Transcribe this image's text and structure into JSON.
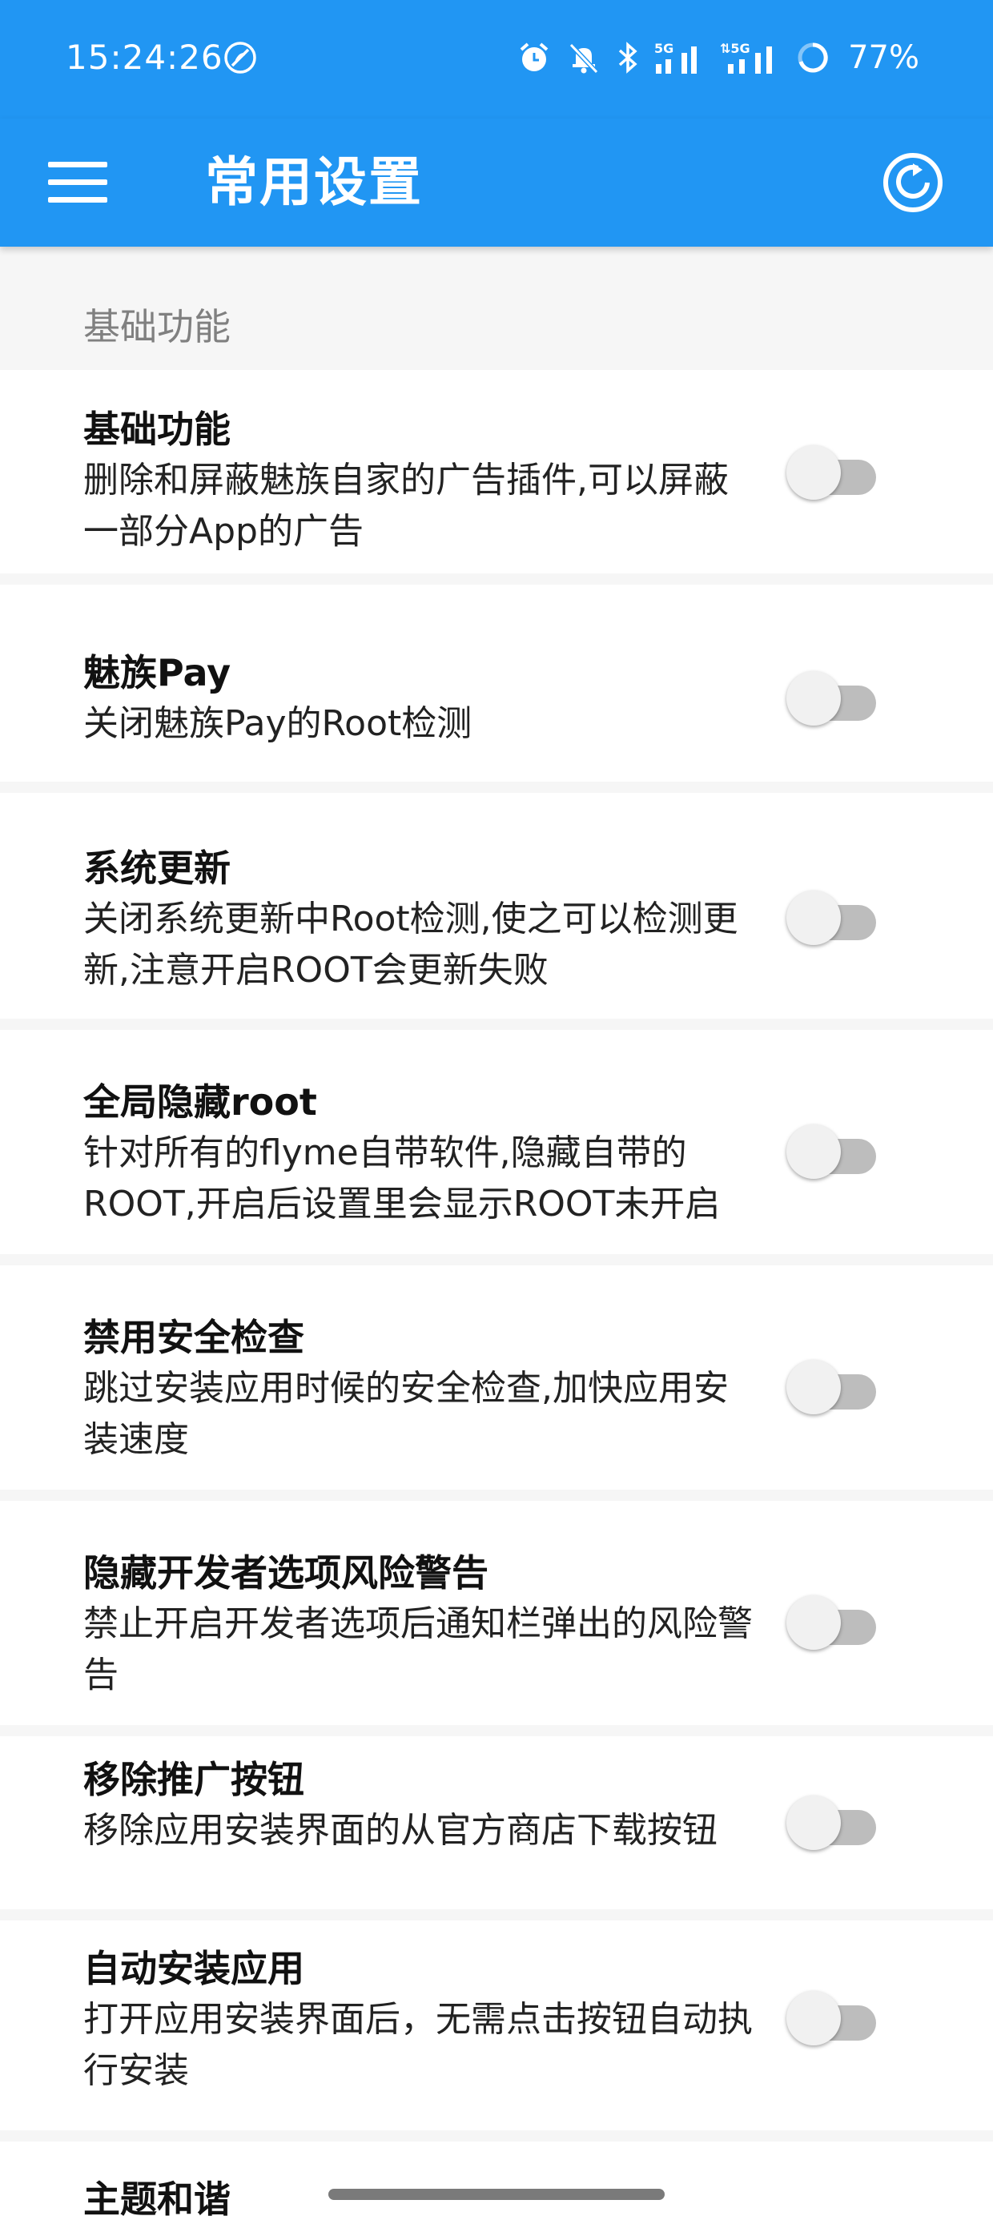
{
  "status_bar": {
    "time": "15:24:26",
    "battery": "77%",
    "icons": [
      "no-tracking-icon",
      "alarm-icon",
      "mute-bell-icon",
      "bluetooth-icon",
      "signal-5g-icon",
      "signal-5g-icon-2",
      "battery-ring-icon"
    ]
  },
  "app_bar": {
    "title": "常用设置",
    "menu_icon": "menu-icon",
    "refresh_icon": "refresh-icon"
  },
  "colors": {
    "primary": "#2196f3",
    "switch_off_track": "#bdbdbd",
    "switch_off_thumb": "#f1f1f1"
  },
  "section": {
    "title": "基础功能"
  },
  "settings": [
    {
      "title": "基础功能",
      "desc": "删除和屏蔽魅族自家的广告插件,可以屏蔽一部分App的广告",
      "enabled": false
    },
    {
      "title": "魅族Pay",
      "desc": "关闭魅族Pay的Root检测",
      "enabled": false
    },
    {
      "title": "系统更新",
      "desc": "关闭系统更新中Root检测,使之可以检测更新,注意开启ROOT会更新失败",
      "enabled": false
    },
    {
      "title": "全局隐藏root",
      "desc": "针对所有的flyme自带软件,隐藏自带的ROOT,开启后设置里会显示ROOT未开启",
      "enabled": false
    },
    {
      "title": "禁用安全检查",
      "desc": "跳过安装应用时候的安全检查,加快应用安装速度",
      "enabled": false
    },
    {
      "title": "隐藏开发者选项风险警告",
      "desc": "禁止开启开发者选项后通知栏弹出的风险警告",
      "enabled": false
    },
    {
      "title": "移除推广按钮",
      "desc": "移除应用安装界面的从官方商店下载按钮",
      "enabled": false
    },
    {
      "title": "自动安装应用",
      "desc": "打开应用安装界面后，无需点击按钮自动执行安装",
      "enabled": false
    },
    {
      "title": "主题和谐",
      "desc": "",
      "enabled": false
    }
  ]
}
